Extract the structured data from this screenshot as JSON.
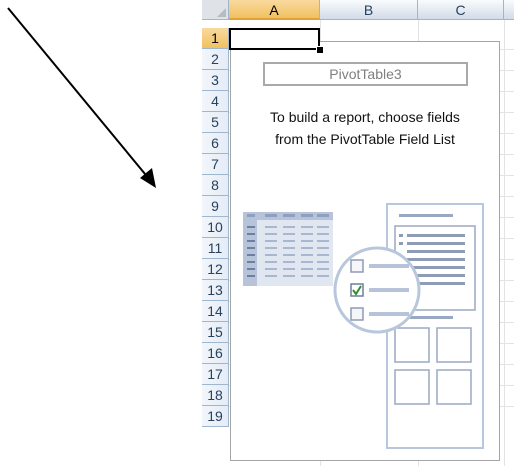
{
  "columns": [
    "A",
    "B",
    "C"
  ],
  "rows": [
    "1",
    "2",
    "3",
    "4",
    "5",
    "6",
    "7",
    "8",
    "9",
    "10",
    "11",
    "12",
    "13",
    "14",
    "15",
    "16",
    "17",
    "18",
    "19"
  ],
  "active_cell": "A1",
  "pivot": {
    "name": "PivotTable3",
    "instruction_line1": "To build a report, choose fields",
    "instruction_line2": "from the PivotTable Field List"
  },
  "icons": {
    "arrow": "diagonal-arrow-icon",
    "illustration": "pivot-field-list-illustration"
  }
}
